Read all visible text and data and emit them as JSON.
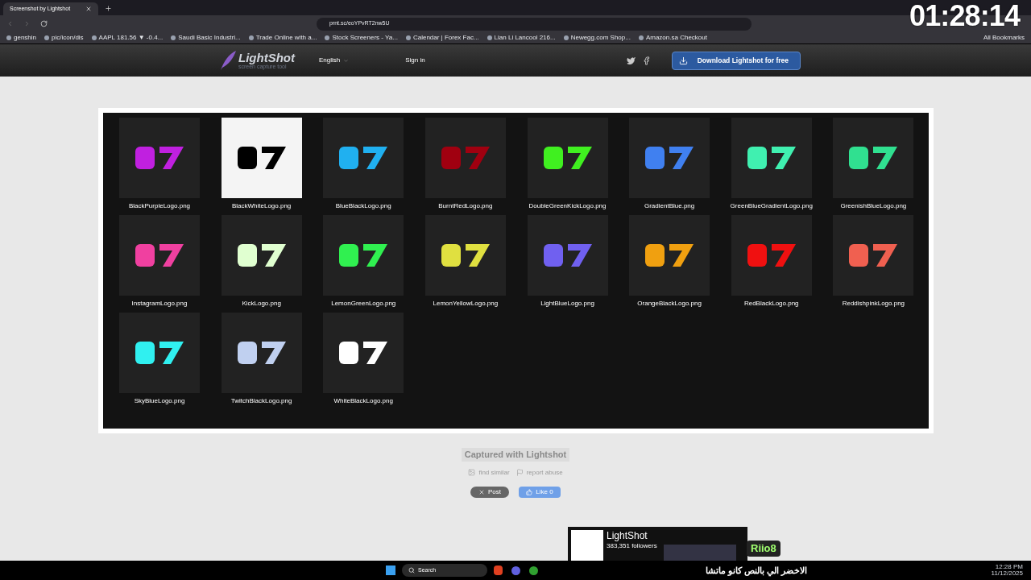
{
  "browser": {
    "tab_title": "Screenshot by Lightshot",
    "url": "prnt.sc/eoYPvRT2nw5U",
    "bookmarks": [
      {
        "label": "genshin"
      },
      {
        "label": "pic/icon/dis"
      },
      {
        "label": "AAPL 181.56 ▼ -0.4..."
      },
      {
        "label": "Saudi Basic Industri..."
      },
      {
        "label": "Trade Online with a..."
      },
      {
        "label": "Stock Screeners - Ya..."
      },
      {
        "label": "Calendar | Forex Fac..."
      },
      {
        "label": "Lian Li Lancool 216..."
      },
      {
        "label": "Newegg.com Shop..."
      },
      {
        "label": "Amazon.sa Checkout"
      }
    ],
    "all_bookmarks": "All Bookmarks"
  },
  "header": {
    "logo": "LightShot",
    "tagline": "screen capture tool",
    "language": "English",
    "sign_in": "Sign in",
    "download": "Download Lightshot for free"
  },
  "files": [
    {
      "name": "BlackPurpleLogo.png",
      "color": "#c020e0"
    },
    {
      "name": "BlackWhiteLogo.png",
      "color": "#000000"
    },
    {
      "name": "BlueBlackLogo.png",
      "color": "#20b0f0"
    },
    {
      "name": "BurntRedLogo.png",
      "color": "#a00010"
    },
    {
      "name": "DoubleGreenKickLogo.png",
      "color": "#40f020"
    },
    {
      "name": "GradientBlue.png",
      "color": "#4080f0"
    },
    {
      "name": "GreenBlueGradientLogo.png",
      "color": "#40f0b0"
    },
    {
      "name": "GreenishBlueLogo.png",
      "color": "#30e090"
    },
    {
      "name": "InstagramLogo.png",
      "color": "#f040a0"
    },
    {
      "name": "KickLogo.png",
      "color": "#e0ffd0"
    },
    {
      "name": "LemonGreenLogo.png",
      "color": "#30f050"
    },
    {
      "name": "LemonYellowLogo.png",
      "color": "#e0e040"
    },
    {
      "name": "LightBlueLogo.png",
      "color": "#7060f0"
    },
    {
      "name": "OrangeBlackLogo.png",
      "color": "#f0a010"
    },
    {
      "name": "RedBlackLogo.png",
      "color": "#f01010"
    },
    {
      "name": "ReddishpinkLogo.png",
      "color": "#f06050"
    },
    {
      "name": "SkyBlueLogo.png",
      "color": "#30f0f0"
    },
    {
      "name": "TwitchBlackLogo.png",
      "color": "#c0d0f0"
    },
    {
      "name": "WhiteBlackLogo.png",
      "color": "#ffffff"
    }
  ],
  "footer": {
    "captured": "Captured with Lightshot",
    "find_similar": "find similar",
    "report_abuse": "report abuse",
    "post": "Post",
    "like": "Like 0"
  },
  "overlay": {
    "timer": "01:28:14",
    "popup_title": "LightShot",
    "popup_followers": "383,351 followers",
    "user": "Riio8",
    "chat": "الاخضر الي بالنص كانو ماتشا"
  },
  "taskbar": {
    "search": "Search",
    "time": "12:28 PM",
    "date": "11/12/2025"
  }
}
